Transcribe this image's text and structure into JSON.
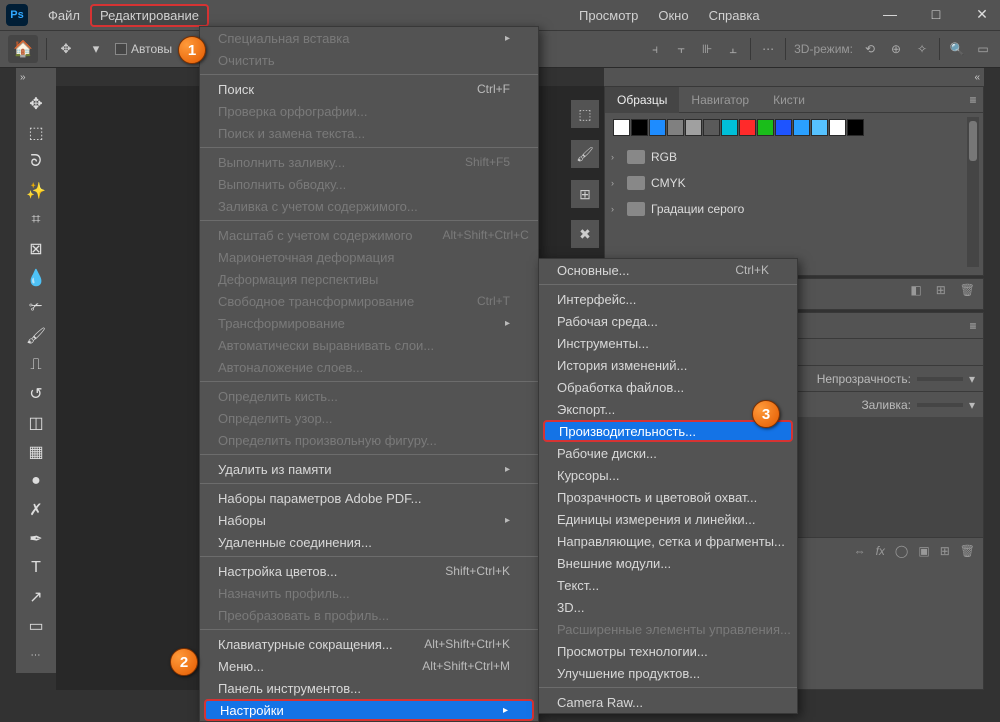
{
  "app": {
    "logo_text": "Ps"
  },
  "menubar": {
    "file": "Файл",
    "edit": "Редактирование",
    "view": "Просмотр",
    "window": "Окно",
    "help": "Справка"
  },
  "optionsbar": {
    "auto_check": "Автовы",
    "mode3d": "3D-режим:"
  },
  "edit_menu": {
    "paste_special": "Специальная вставка",
    "clear": "Очистить",
    "search": "Поиск",
    "search_sc": "Ctrl+F",
    "spelling": "Проверка орфографии...",
    "find_replace": "Поиск и замена текста...",
    "fill": "Выполнить заливку...",
    "fill_sc": "Shift+F5",
    "stroke": "Выполнить обводку...",
    "content_fill": "Заливка с учетом содержимого...",
    "content_scale": "Масштаб с учетом содержимого",
    "content_scale_sc": "Alt+Shift+Ctrl+C",
    "puppet": "Марионеточная деформация",
    "perspective": "Деформация перспективы",
    "free_transform": "Свободное трансформирование",
    "free_transform_sc": "Ctrl+T",
    "transform": "Трансформирование",
    "auto_align": "Автоматически выравнивать слои...",
    "auto_blend": "Автоналожение слоев...",
    "define_brush": "Определить кисть...",
    "define_pattern": "Определить узор...",
    "define_shape": "Определить произвольную фигуру...",
    "purge": "Удалить из памяти",
    "pdf_presets": "Наборы параметров Adobe PDF...",
    "presets": "Наборы",
    "remote": "Удаленные соединения...",
    "color_settings": "Настройка цветов...",
    "color_settings_sc": "Shift+Ctrl+K",
    "assign_profile": "Назначить профиль...",
    "convert_profile": "Преобразовать в профиль...",
    "keyboard": "Клавиатурные сокращения...",
    "keyboard_sc": "Alt+Shift+Ctrl+K",
    "menus": "Меню...",
    "menus_sc": "Alt+Shift+Ctrl+M",
    "toolbar": "Панель инструментов...",
    "preferences": "Настройки"
  },
  "prefs_menu": {
    "general": "Основные...",
    "general_sc": "Ctrl+K",
    "interface": "Интерфейс...",
    "workspace": "Рабочая среда...",
    "tools": "Инструменты...",
    "history": "История изменений...",
    "file_handling": "Обработка файлов...",
    "export": "Экспорт...",
    "performance": "Производительность...",
    "scratch": "Рабочие диски...",
    "cursors": "Курсоры...",
    "transparency": "Прозрачность и цветовой охват...",
    "units": "Единицы измерения и линейки...",
    "guides": "Направляющие, сетка и фрагменты...",
    "plugins": "Внешние модули...",
    "type": "Текст...",
    "threeD": "3D...",
    "enhanced": "Расширенные элементы управления...",
    "tech_preview": "Просмотры технологии...",
    "product": "Улучшение продуктов...",
    "camera_raw": "Camera Raw..."
  },
  "panels": {
    "swatches_tab": "Образцы",
    "navigator_tab": "Навигатор",
    "brushes_tab": "Кисти",
    "rgb_folder": "RGB",
    "cmyk_folder": "CMYK",
    "gray_folder": "Градации серого",
    "opacity": "Непрозрачность:",
    "fill": "Заливка:"
  },
  "swatch_colors": [
    "#ffffff",
    "#000000",
    "#1e8cff",
    "#808080",
    "#a0a0a0",
    "#5a5a5a",
    "#00bfd8",
    "#ff2a2a",
    "#1abd1a",
    "#1e54ff",
    "#2aa0ff",
    "#56c2ff",
    "#ffffff",
    "#000000"
  ],
  "badges": {
    "one": "1",
    "two": "2",
    "three": "3"
  }
}
